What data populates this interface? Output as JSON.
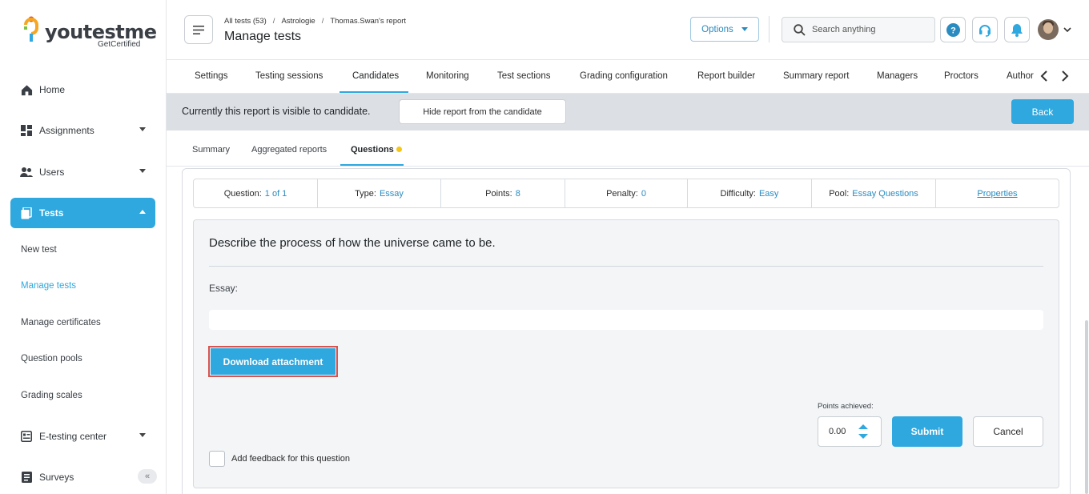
{
  "brand": {
    "name": "youtestme",
    "sub": "GetCertified",
    "accent": "#2ea8df"
  },
  "sidebar": {
    "items": [
      {
        "label": "Home",
        "icon": "home-icon"
      },
      {
        "label": "Assignments",
        "icon": "assignments-icon"
      },
      {
        "label": "Users",
        "icon": "users-icon"
      },
      {
        "label": "Tests",
        "icon": "tests-icon"
      },
      {
        "label": "E-testing center",
        "icon": "etesting-icon"
      },
      {
        "label": "Surveys",
        "icon": "surveys-icon"
      }
    ],
    "sub_items": [
      "New test",
      "Manage tests",
      "Manage certificates",
      "Question pools",
      "Grading scales"
    ],
    "collapse_glyph": "«"
  },
  "header": {
    "breadcrumbs": [
      "All tests (53)",
      "Astrologie",
      "Thomas.Swan's report"
    ],
    "crumb_sep": "/",
    "title": "Manage tests",
    "options_label": "Options",
    "search_placeholder": "Search anything"
  },
  "tabs": [
    "Settings",
    "Testing sessions",
    "Candidates",
    "Monitoring",
    "Test sections",
    "Grading configuration",
    "Report builder",
    "Summary report",
    "Managers",
    "Proctors",
    "Author"
  ],
  "visibility": {
    "message": "Currently this report is visible to candidate.",
    "hide_label": "Hide report from the candidate",
    "back_label": "Back"
  },
  "subtabs": [
    "Summary",
    "Aggregated reports",
    "Questions"
  ],
  "question_info": {
    "question_label": "Question:",
    "question_value": "1 of 1",
    "type_label": "Type:",
    "type_value": "Essay",
    "points_label": "Points:",
    "points_value": "8",
    "penalty_label": "Penalty:",
    "penalty_value": "0",
    "difficulty_label": "Difficulty:",
    "difficulty_value": "Easy",
    "pool_label": "Pool:",
    "pool_value": "Essay Questions",
    "properties_label": "Properties"
  },
  "question": {
    "text": "Describe the process of how the universe came to be.",
    "essay_label": "Essay:",
    "download_label": "Download attachment",
    "points_achieved_label": "Points achieved:",
    "points_value": "0.00",
    "submit_label": "Submit",
    "cancel_label": "Cancel",
    "feedback_label": "Add feedback for this question"
  }
}
